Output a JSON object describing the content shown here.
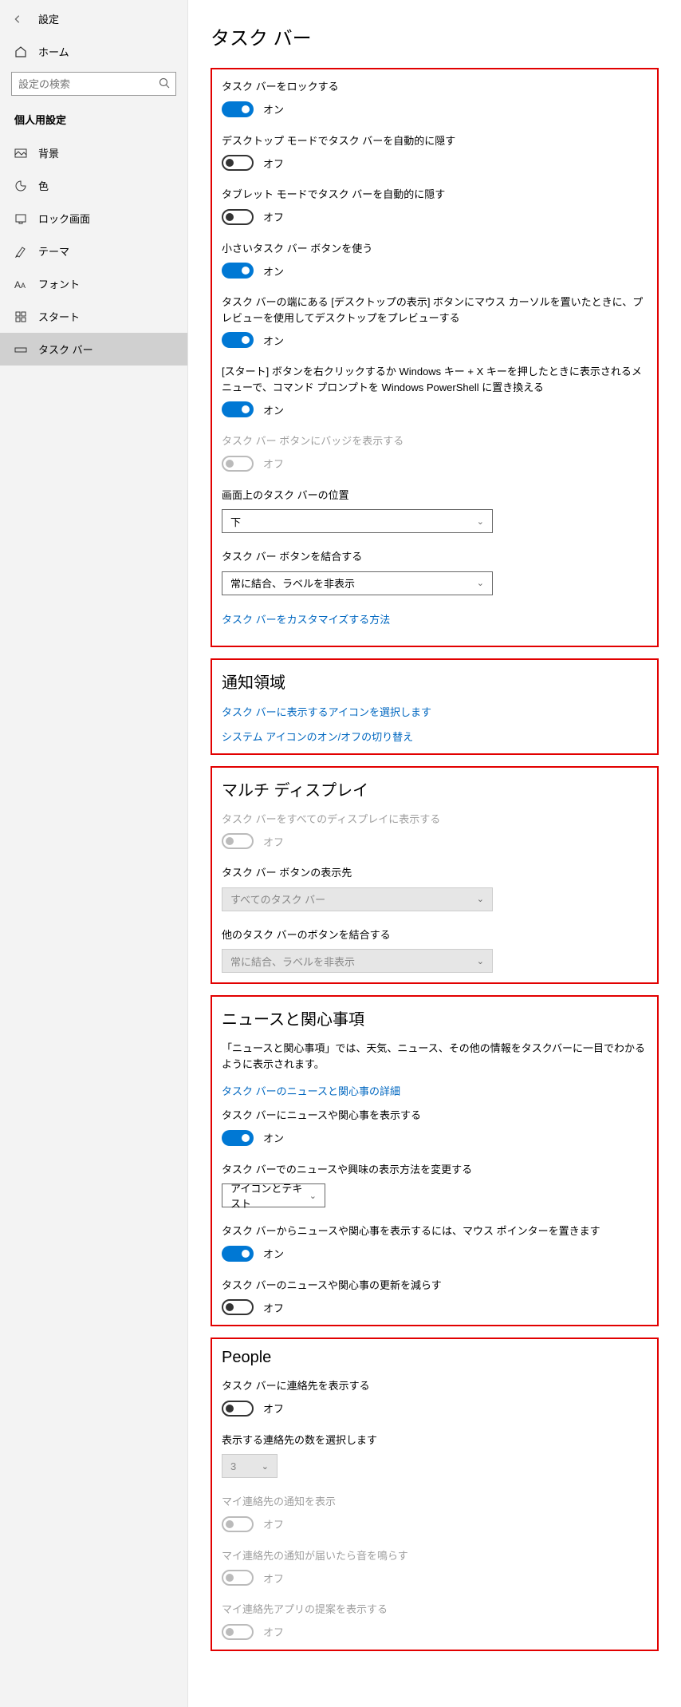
{
  "header": {
    "title": "設定"
  },
  "sidebar": {
    "home": "ホーム",
    "search_placeholder": "設定の検索",
    "section": "個人用設定",
    "items": [
      {
        "label": "背景"
      },
      {
        "label": "色"
      },
      {
        "label": "ロック画面"
      },
      {
        "label": "テーマ"
      },
      {
        "label": "フォント"
      },
      {
        "label": "スタート"
      },
      {
        "label": "タスク バー"
      }
    ]
  },
  "page_title": "タスク バー",
  "taskbar": {
    "lock": {
      "label": "タスク バーをロックする",
      "value": "オン"
    },
    "autohide_desktop": {
      "label": "デスクトップ モードでタスク バーを自動的に隠す",
      "value": "オフ"
    },
    "autohide_tablet": {
      "label": "タブレット モードでタスク バーを自動的に隠す",
      "value": "オフ"
    },
    "small_buttons": {
      "label": "小さいタスク バー ボタンを使う",
      "value": "オン"
    },
    "peek": {
      "label": "タスク バーの端にある [デスクトップの表示] ボタンにマウス カーソルを置いたときに、プレビューを使用してデスクトップをプレビューする",
      "value": "オン"
    },
    "powershell": {
      "label": "[スタート] ボタンを右クリックするか Windows キー + X キーを押したときに表示されるメニューで、コマンド プロンプトを Windows PowerShell に置き換える",
      "value": "オン"
    },
    "badges": {
      "label": "タスク バー ボタンにバッジを表示する",
      "value": "オフ"
    },
    "position": {
      "label": "画面上のタスク バーの位置",
      "value": "下"
    },
    "combine": {
      "label": "タスク バー ボタンを結合する",
      "value": "常に結合、ラベルを非表示"
    },
    "customize_link": "タスク バーをカスタマイズする方法"
  },
  "notification": {
    "heading": "通知領域",
    "link1": "タスク バーに表示するアイコンを選択します",
    "link2": "システム アイコンのオン/オフの切り替え"
  },
  "multi": {
    "heading": "マルチ ディスプレイ",
    "show_all": {
      "label": "タスク バーをすべてのディスプレイに表示する",
      "value": "オフ"
    },
    "button_dest": {
      "label": "タスク バー ボタンの表示先",
      "value": "すべてのタスク バー"
    },
    "other_combine": {
      "label": "他のタスク バーのボタンを結合する",
      "value": "常に結合、ラベルを非表示"
    }
  },
  "news": {
    "heading": "ニュースと関心事項",
    "desc": "「ニュースと関心事項」では、天気、ニュース、その他の情報をタスクバーに一目でわかるように表示されます。",
    "detail_link": "タスク バーのニュースと関心事の詳細",
    "show": {
      "label": "タスク バーにニュースや関心事を表示する",
      "value": "オン"
    },
    "display_method": {
      "label": "タスク バーでのニュースや興味の表示方法を変更する",
      "value": "アイコンとテキスト"
    },
    "hover": {
      "label": "タスク バーからニュースや関心事を表示するには、マウス ポインターを置きます",
      "value": "オン"
    },
    "reduce": {
      "label": "タスク バーのニュースや関心事の更新を減らす",
      "value": "オフ"
    }
  },
  "people": {
    "heading": "People",
    "show_contacts": {
      "label": "タスク バーに連絡先を表示する",
      "value": "オフ"
    },
    "contact_count": {
      "label": "表示する連絡先の数を選択します",
      "value": "3"
    },
    "my_notif": {
      "label": "マイ連絡先の通知を表示",
      "value": "オフ"
    },
    "my_sound": {
      "label": "マイ連絡先の通知が届いたら音を鳴らす",
      "value": "オフ"
    },
    "my_suggest": {
      "label": "マイ連絡先アプリの提案を表示する",
      "value": "オフ"
    }
  }
}
